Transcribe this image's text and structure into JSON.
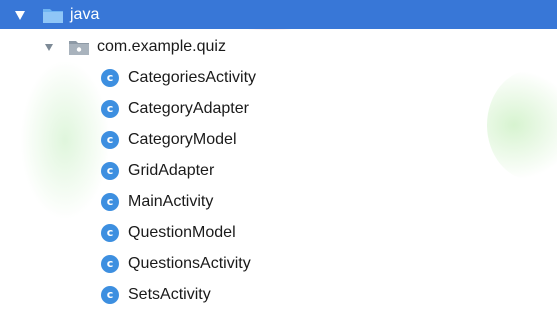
{
  "tree": {
    "root": {
      "label": "java",
      "expanded": true,
      "icon": "folder-icon",
      "selected_color": "#3877d7"
    },
    "package": {
      "label": "com.example.quiz",
      "expanded": true,
      "icon": "package-folder-icon"
    },
    "class_icon_letter": "c",
    "class_icon_color": "#3d8fe0",
    "classes": [
      {
        "label": "CategoriesActivity"
      },
      {
        "label": "CategoryAdapter"
      },
      {
        "label": "CategoryModel"
      },
      {
        "label": "GridAdapter"
      },
      {
        "label": "MainActivity"
      },
      {
        "label": "QuestionModel"
      },
      {
        "label": "QuestionsActivity"
      },
      {
        "label": "SetsActivity"
      }
    ]
  }
}
